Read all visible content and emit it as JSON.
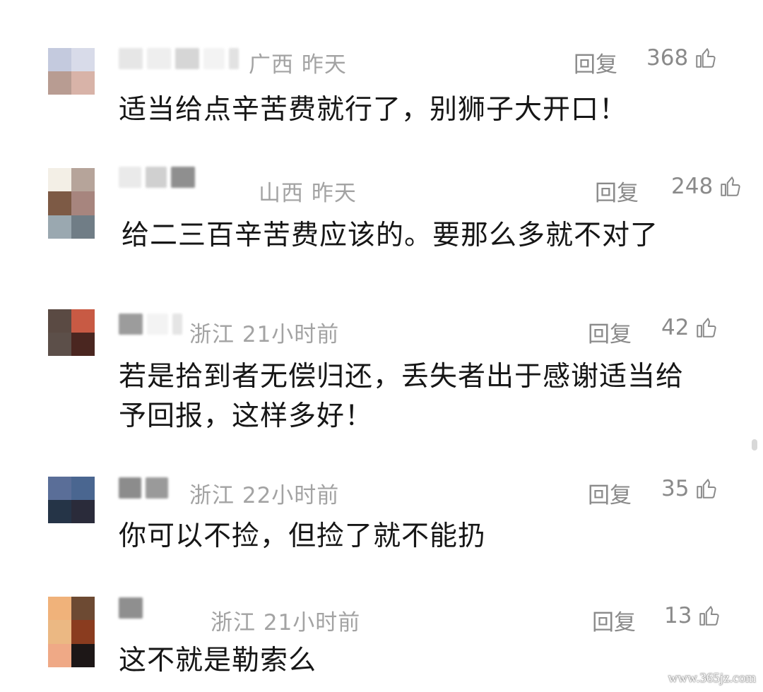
{
  "comments": [
    {
      "location_time": "广西 昨天",
      "reply_label": "回复",
      "likes": "368",
      "text_lines": [
        "适当给点辛苦费就行了，别狮子大开口！"
      ],
      "avatar_colors": [
        "#c4cade",
        "#d8dbe9",
        "#b89c92",
        "#d8b3a8"
      ]
    },
    {
      "location_time": "山西 昨天",
      "reply_label": "回复",
      "likes": "248",
      "text_lines": [
        "给二三百辛苦费应该的。要那么多就不对了"
      ],
      "avatar_colors": [
        "#f3efe6",
        "#b6a49a",
        "#7d5a45",
        "#a7857e",
        "#9aa8b0",
        "#707d86"
      ]
    },
    {
      "location_time": "浙江 21小时前",
      "reply_label": "回复",
      "likes": "42",
      "text_lines": [
        "若是拾到者无偿归还，丢失者出于感谢适当给",
        "予回报，这样多好！"
      ],
      "avatar_colors": [
        "#5a4a43",
        "#c85a44",
        "#5c4f49",
        "#4a2620"
      ]
    },
    {
      "location_time": "浙江 22小时前",
      "reply_label": "回复",
      "likes": "35",
      "text_lines": [
        "你可以不捡，但捡了就不能扔"
      ],
      "avatar_colors": [
        "#5a6e98",
        "#4a6690",
        "#253447",
        "#2a2b3a"
      ]
    },
    {
      "location_time": "浙江 21小时前",
      "reply_label": "回复",
      "likes": "13",
      "text_lines": [
        "这不就是勒索么"
      ],
      "avatar_colors": [
        "#f0b27a",
        "#6d4a33",
        "#ebb883",
        "#8a3c1f",
        "#efa986",
        "#1d1717"
      ]
    }
  ],
  "watermark": "www.365jz.com"
}
